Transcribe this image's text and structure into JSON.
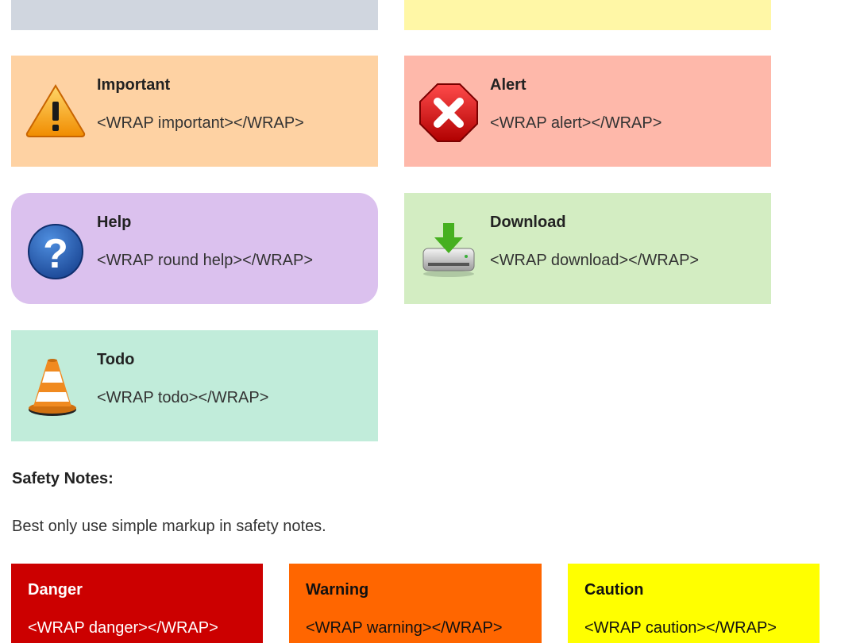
{
  "boxes": {
    "important": {
      "title": "Important",
      "code": "<WRAP important></WRAP>",
      "color": "#fed2a3"
    },
    "alert": {
      "title": "Alert",
      "code": "<WRAP alert></WRAP>",
      "color": "#feb8aa"
    },
    "help": {
      "title": "Help",
      "code": "<WRAP round help></WRAP>",
      "color": "#dbc1ee"
    },
    "download": {
      "title": "Download",
      "code": "<WRAP download></WRAP>",
      "color": "#d3edc2"
    },
    "todo": {
      "title": "Todo",
      "code": "<WRAP todo></WRAP>",
      "color": "#c1ecda"
    }
  },
  "safety": {
    "heading": "Safety Notes:",
    "text": "Best only use simple markup in safety notes.",
    "danger": {
      "title": "Danger",
      "code": "<WRAP danger></WRAP>",
      "color": "#cc0000"
    },
    "warning": {
      "title": "Warning",
      "code": "<WRAP warning></WRAP>",
      "color": "#ff6600"
    },
    "caution": {
      "title": "Caution",
      "code": "<WRAP caution></WRAP>",
      "color": "#ffff00"
    }
  },
  "icons": {
    "important": "warning-triangle-icon",
    "alert": "stop-x-icon",
    "help": "question-mark-icon",
    "download": "download-drive-icon",
    "todo": "traffic-cone-icon"
  }
}
